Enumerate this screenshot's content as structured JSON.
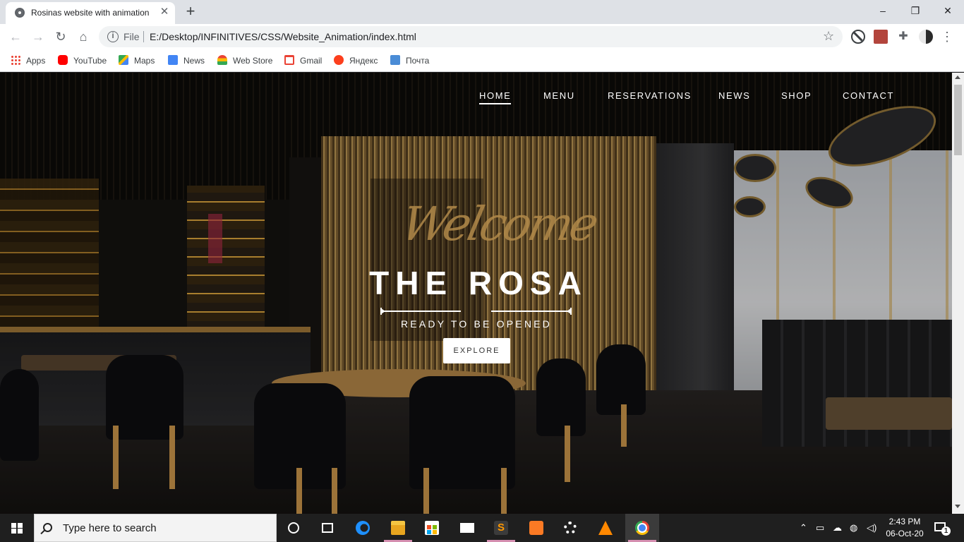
{
  "browser": {
    "tab_title": "Rosinas website with animation",
    "new_tab_symbol": "+",
    "window_controls": {
      "minimize": "–",
      "restore": "❐",
      "close": "✕"
    },
    "url_scheme": "File",
    "url": "E:/Desktop/INFINITIVES/CSS/Website_Animation/index.html",
    "bookmarks": [
      {
        "label": "Apps",
        "icon": "apps-grid-icon"
      },
      {
        "label": "YouTube",
        "icon": "youtube-icon"
      },
      {
        "label": "Maps",
        "icon": "maps-icon"
      },
      {
        "label": "News",
        "icon": "news-icon"
      },
      {
        "label": "Web Store",
        "icon": "web-store-icon"
      },
      {
        "label": "Gmail",
        "icon": "gmail-icon"
      },
      {
        "label": "Яндекс",
        "icon": "yandex-icon"
      },
      {
        "label": "Почта",
        "icon": "mail-icon"
      }
    ]
  },
  "site": {
    "nav": [
      {
        "label": "HOME",
        "active": true
      },
      {
        "label": "MENU",
        "active": false
      },
      {
        "label": "RESERVATIONS",
        "active": false
      },
      {
        "label": "NEWS",
        "active": false
      },
      {
        "label": "SHOP",
        "active": false
      },
      {
        "label": "CONTACT",
        "active": false
      }
    ],
    "hero": {
      "script_text": "Welcome",
      "title": "THE ROSA",
      "subtitle": "READY TO BE OPENED",
      "button": "EXPLORE"
    }
  },
  "taskbar": {
    "search_placeholder": "Type here to search",
    "time": "2:43 PM",
    "date": "06-Oct-20",
    "notification_count": "1",
    "apps": [
      "cortana-icon",
      "task-view-icon",
      "edge-icon",
      "file-explorer-icon",
      "store-icon",
      "mail-icon",
      "sublime-text-icon",
      "xampp-icon",
      "settings-icon",
      "vlc-icon",
      "chrome-icon"
    ]
  },
  "colors": {
    "tab_strip": "#dee1e6",
    "taskbar": "#1f1f1f",
    "script_gold": "#b28a4a",
    "hero_text": "#ffffff"
  }
}
